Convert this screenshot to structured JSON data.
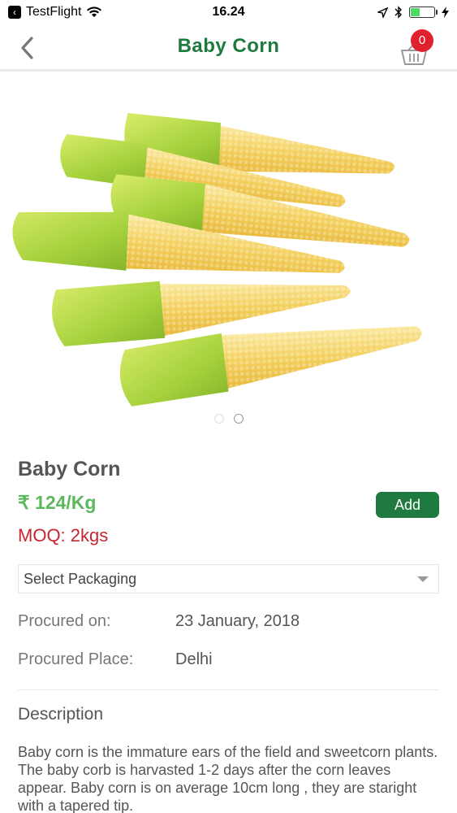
{
  "status_bar": {
    "app_back": "TestFlight",
    "time": "16.24"
  },
  "nav": {
    "title": "Baby Corn",
    "cart_count": "0"
  },
  "carousel": {
    "image": "baby-corn-photo",
    "pages": 2,
    "active_page": 1
  },
  "product": {
    "name": "Baby Corn",
    "price": "₹ 124/Kg",
    "moq": "MOQ: 2kgs",
    "add_label": "Add"
  },
  "packaging": {
    "selected": "Select Packaging"
  },
  "details": {
    "procured_on_label": "Procured on:",
    "procured_on_value": "23 January, 2018",
    "procured_place_label": "Procured Place:",
    "procured_place_value": "Delhi"
  },
  "description": {
    "heading": "Description",
    "body": "Baby corn is the immature ears of the field and sweetcorn plants. The baby corb is harvasted 1-2 days after the corn leaves appear. Baby corn is on average 10cm long , they are staright with a tapered tip."
  },
  "colors": {
    "brand_green": "#1e7a3e",
    "price_green": "#5cb85c",
    "moq_red": "#c9252f",
    "badge_red": "#e0202c"
  }
}
